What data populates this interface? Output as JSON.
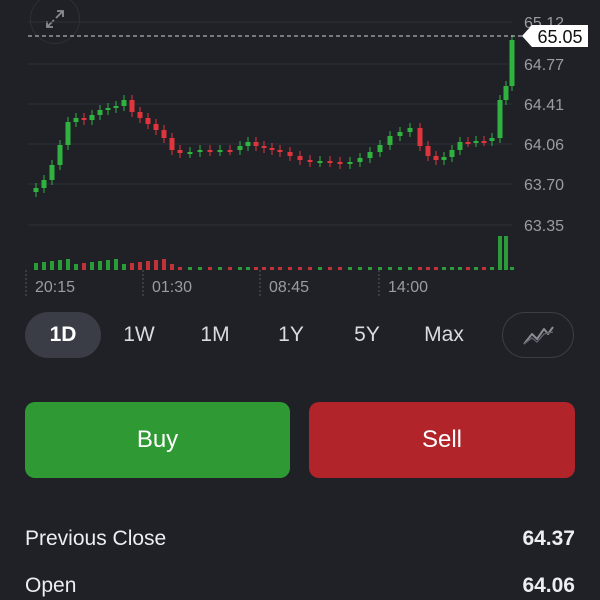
{
  "chart": {
    "type": "candlestick",
    "price_ticks": [
      "65.12",
      "64.77",
      "64.41",
      "64.06",
      "63.70",
      "63.35"
    ],
    "current_price": "65.05",
    "time_ticks": [
      "20:15",
      "01:30",
      "08:45",
      "14:00"
    ],
    "colors": {
      "up": "#2fb240",
      "down": "#e0353c",
      "grid": "#2b2e35",
      "axis_text": "#9a9ca3"
    }
  },
  "timeframes": [
    {
      "label": "1D",
      "active": true
    },
    {
      "label": "1W",
      "active": false
    },
    {
      "label": "1M",
      "active": false
    },
    {
      "label": "1Y",
      "active": false
    },
    {
      "label": "5Y",
      "active": false
    },
    {
      "label": "Max",
      "active": false
    }
  ],
  "actions": {
    "buy_label": "Buy",
    "sell_label": "Sell"
  },
  "stats": [
    {
      "label": "Previous Close",
      "value": "64.37"
    },
    {
      "label": "Open",
      "value": "64.06"
    }
  ],
  "icons": {
    "expand": "expand-icon",
    "chart_style": "line-chart-icon"
  }
}
